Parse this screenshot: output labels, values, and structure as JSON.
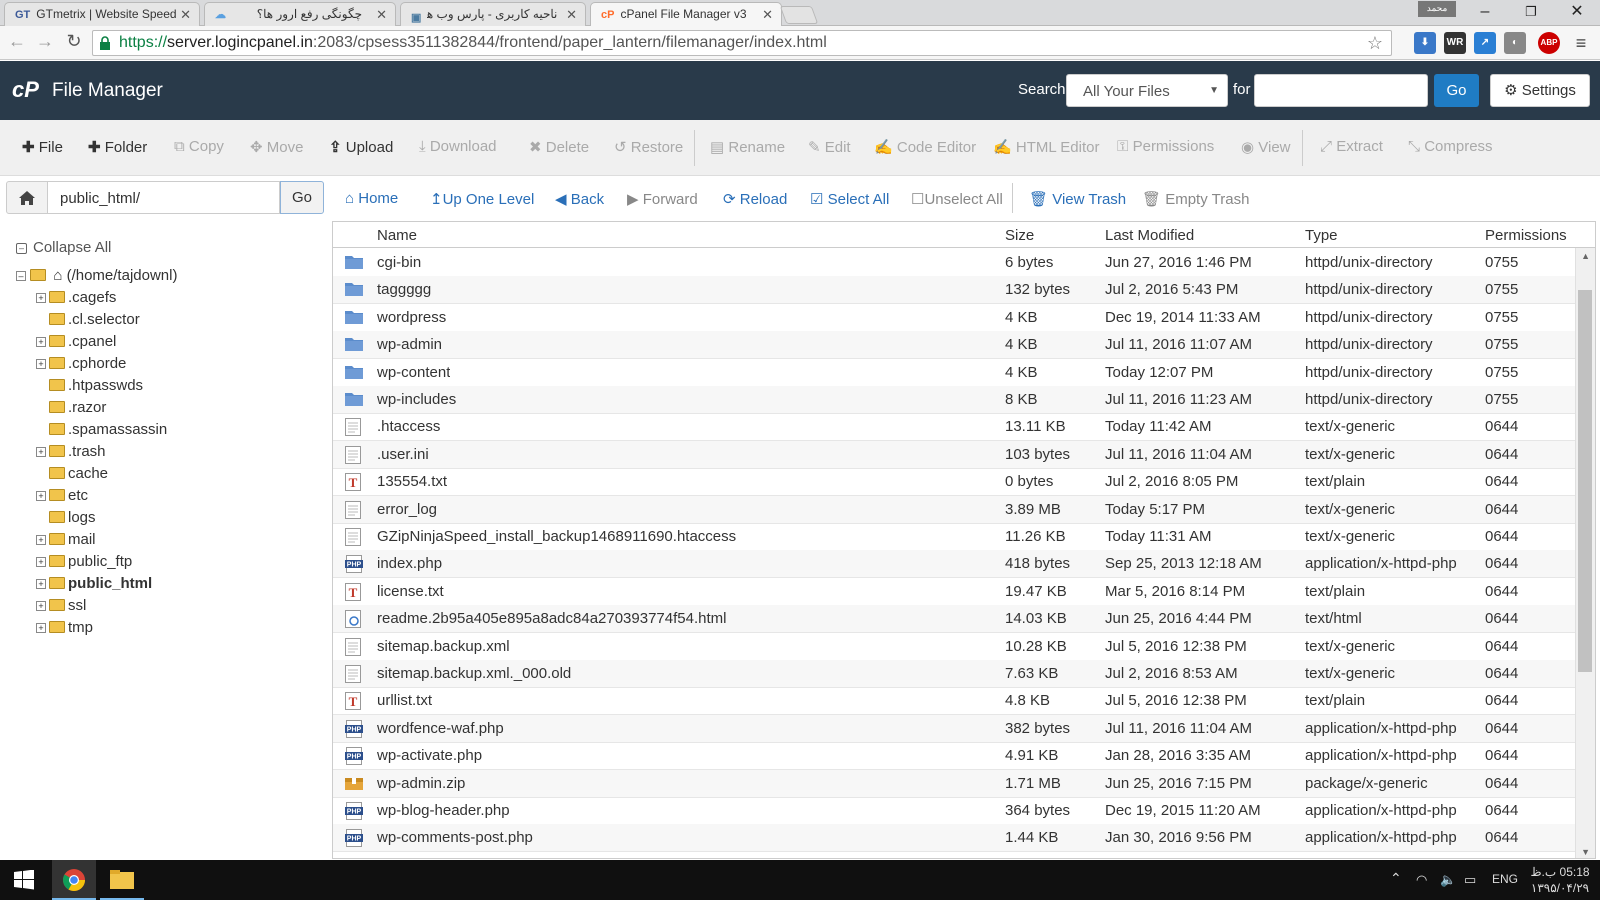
{
  "browser": {
    "tabs": [
      {
        "favicon": "GT",
        "title": "GTmetrix | Website Speed",
        "active": false
      },
      {
        "favicon": "cloud",
        "title": "چگونگی رفع ارور ها؟",
        "active": false
      },
      {
        "favicon": "page",
        "title": "ناحیه کاربری - پارس وب هاست",
        "active": false
      },
      {
        "favicon": "cP",
        "title": "cPanel File Manager v3",
        "active": true
      }
    ],
    "profile_name": "محمد",
    "url_scheme": "https://",
    "url_host": "server.logincpanel.in",
    "url_rest": ":2083/cpsess3511382844/frontend/paper_lantern/filemanager/index.html"
  },
  "header": {
    "logo": "cP",
    "title": "File Manager",
    "search_label": "Search",
    "search_scope": "All Your Files",
    "for_label": "for",
    "search_value": "",
    "go_label": "Go",
    "settings_label": "Settings"
  },
  "toolbar": [
    {
      "label": "File",
      "icon": "plus-icon",
      "enabled": true
    },
    {
      "label": "Folder",
      "icon": "plus-icon",
      "enabled": true
    },
    {
      "label": "Copy",
      "icon": "copy-icon",
      "enabled": false
    },
    {
      "label": "Move",
      "icon": "move-icon",
      "enabled": false
    },
    {
      "label": "Upload",
      "icon": "upload-icon",
      "enabled": true
    },
    {
      "label": "Download",
      "icon": "download-icon",
      "enabled": false
    },
    {
      "label": "Delete",
      "icon": "times-icon",
      "enabled": false
    },
    {
      "label": "Restore",
      "icon": "undo-icon",
      "enabled": false
    },
    {
      "label": "Rename",
      "icon": "file-icon",
      "enabled": false
    },
    {
      "label": "Edit",
      "icon": "pencil-icon",
      "enabled": false
    },
    {
      "label": "Code Editor",
      "icon": "edit-icon",
      "enabled": false
    },
    {
      "label": "HTML Editor",
      "icon": "edit-icon",
      "enabled": false
    },
    {
      "label": "Permissions",
      "icon": "key-icon",
      "enabled": false
    },
    {
      "label": "View",
      "icon": "eye-icon",
      "enabled": false
    },
    {
      "label": "Extract",
      "icon": "expand-icon",
      "enabled": false
    },
    {
      "label": "Compress",
      "icon": "compress-icon",
      "enabled": false
    }
  ],
  "pathbar": {
    "path": "public_html/",
    "go_label": "Go"
  },
  "nav": [
    {
      "label": "Home",
      "icon": "home-icon",
      "enabled": true
    },
    {
      "label": "Up One Level",
      "icon": "arrow-up-icon",
      "enabled": true
    },
    {
      "label": "Back",
      "icon": "arrow-left-icon",
      "enabled": true
    },
    {
      "label": "Forward",
      "icon": "arrow-right-icon",
      "enabled": false
    },
    {
      "label": "Reload",
      "icon": "refresh-icon",
      "enabled": true
    },
    {
      "label": "Select All",
      "icon": "checkbox-checked-icon",
      "enabled": true
    },
    {
      "label": "Unselect All",
      "icon": "checkbox-empty-icon",
      "enabled": false
    },
    {
      "label": "View Trash",
      "icon": "trash-icon",
      "enabled": true
    },
    {
      "label": "Empty Trash",
      "icon": "trash-icon",
      "enabled": false
    }
  ],
  "tree": {
    "collapse_label": "Collapse All",
    "root": "(/home/tajdownl)",
    "items": [
      {
        "name": ".cagefs",
        "expandable": true,
        "bold": false
      },
      {
        "name": ".cl.selector",
        "expandable": false,
        "bold": false
      },
      {
        "name": ".cpanel",
        "expandable": true,
        "bold": false
      },
      {
        "name": ".cphorde",
        "expandable": true,
        "bold": false
      },
      {
        "name": ".htpasswds",
        "expandable": false,
        "bold": false
      },
      {
        "name": ".razor",
        "expandable": false,
        "bold": false
      },
      {
        "name": ".spamassassin",
        "expandable": false,
        "bold": false
      },
      {
        "name": ".trash",
        "expandable": true,
        "bold": false
      },
      {
        "name": "cache",
        "expandable": false,
        "bold": false
      },
      {
        "name": "etc",
        "expandable": true,
        "bold": false
      },
      {
        "name": "logs",
        "expandable": false,
        "bold": false
      },
      {
        "name": "mail",
        "expandable": true,
        "bold": false
      },
      {
        "name": "public_ftp",
        "expandable": true,
        "bold": false
      },
      {
        "name": "public_html",
        "expandable": true,
        "bold": true
      },
      {
        "name": "ssl",
        "expandable": true,
        "bold": false
      },
      {
        "name": "tmp",
        "expandable": true,
        "bold": false
      }
    ]
  },
  "table": {
    "columns": [
      "Name",
      "Size",
      "Last Modified",
      "Type",
      "Permissions"
    ],
    "rows": [
      {
        "icon": "folder",
        "name": "cgi-bin",
        "size": "6 bytes",
        "modified": "Jun 27, 2016 1:46 PM",
        "type": "httpd/unix-directory",
        "perms": "0755"
      },
      {
        "icon": "folder",
        "name": "taggggg",
        "size": "132 bytes",
        "modified": "Jul 2, 2016 5:43 PM",
        "type": "httpd/unix-directory",
        "perms": "0755"
      },
      {
        "icon": "folder",
        "name": "wordpress",
        "size": "4 KB",
        "modified": "Dec 19, 2014 11:33 AM",
        "type": "httpd/unix-directory",
        "perms": "0755"
      },
      {
        "icon": "folder",
        "name": "wp-admin",
        "size": "4 KB",
        "modified": "Jul 11, 2016 11:07 AM",
        "type": "httpd/unix-directory",
        "perms": "0755"
      },
      {
        "icon": "folder",
        "name": "wp-content",
        "size": "4 KB",
        "modified": "Today 12:07 PM",
        "type": "httpd/unix-directory",
        "perms": "0755"
      },
      {
        "icon": "folder",
        "name": "wp-includes",
        "size": "8 KB",
        "modified": "Jul 11, 2016 11:23 AM",
        "type": "httpd/unix-directory",
        "perms": "0755"
      },
      {
        "icon": "generic",
        "name": ".htaccess",
        "size": "13.11 KB",
        "modified": "Today 11:42 AM",
        "type": "text/x-generic",
        "perms": "0644"
      },
      {
        "icon": "generic",
        "name": ".user.ini",
        "size": "103 bytes",
        "modified": "Jul 11, 2016 11:04 AM",
        "type": "text/x-generic",
        "perms": "0644"
      },
      {
        "icon": "text",
        "name": "135554.txt",
        "size": "0 bytes",
        "modified": "Jul 2, 2016 8:05 PM",
        "type": "text/plain",
        "perms": "0644"
      },
      {
        "icon": "generic",
        "name": "error_log",
        "size": "3.89 MB",
        "modified": "Today 5:17 PM",
        "type": "text/x-generic",
        "perms": "0644"
      },
      {
        "icon": "generic",
        "name": "GZipNinjaSpeed_install_backup1468911690.htaccess",
        "size": "11.26 KB",
        "modified": "Today 11:31 AM",
        "type": "text/x-generic",
        "perms": "0644"
      },
      {
        "icon": "php",
        "name": "index.php",
        "size": "418 bytes",
        "modified": "Sep 25, 2013 12:18 AM",
        "type": "application/x-httpd-php",
        "perms": "0644"
      },
      {
        "icon": "text",
        "name": "license.txt",
        "size": "19.47 KB",
        "modified": "Mar 5, 2016 8:14 PM",
        "type": "text/plain",
        "perms": "0644"
      },
      {
        "icon": "html",
        "name": "readme.2b95a405e895a8adc84a270393774f54.html",
        "size": "14.03 KB",
        "modified": "Jun 25, 2016 4:44 PM",
        "type": "text/html",
        "perms": "0644"
      },
      {
        "icon": "generic",
        "name": "sitemap.backup.xml",
        "size": "10.28 KB",
        "modified": "Jul 5, 2016 12:38 PM",
        "type": "text/x-generic",
        "perms": "0644"
      },
      {
        "icon": "generic",
        "name": "sitemap.backup.xml._000.old",
        "size": "7.63 KB",
        "modified": "Jul 2, 2016 8:53 AM",
        "type": "text/x-generic",
        "perms": "0644"
      },
      {
        "icon": "text",
        "name": "urllist.txt",
        "size": "4.8 KB",
        "modified": "Jul 5, 2016 12:38 PM",
        "type": "text/plain",
        "perms": "0644"
      },
      {
        "icon": "php",
        "name": "wordfence-waf.php",
        "size": "382 bytes",
        "modified": "Jul 11, 2016 11:04 AM",
        "type": "application/x-httpd-php",
        "perms": "0644"
      },
      {
        "icon": "php",
        "name": "wp-activate.php",
        "size": "4.91 KB",
        "modified": "Jan 28, 2016 3:35 AM",
        "type": "application/x-httpd-php",
        "perms": "0644"
      },
      {
        "icon": "archive",
        "name": "wp-admin.zip",
        "size": "1.71 MB",
        "modified": "Jun 25, 2016 7:15 PM",
        "type": "package/x-generic",
        "perms": "0644"
      },
      {
        "icon": "php",
        "name": "wp-blog-header.php",
        "size": "364 bytes",
        "modified": "Dec 19, 2015 11:20 AM",
        "type": "application/x-httpd-php",
        "perms": "0644"
      },
      {
        "icon": "php",
        "name": "wp-comments-post.php",
        "size": "1.44 KB",
        "modified": "Jan 30, 2016 9:56 PM",
        "type": "application/x-httpd-php",
        "perms": "0644"
      }
    ]
  },
  "taskbar": {
    "language": "ENG",
    "time": "05:18 ب.ظ",
    "date": "۱۳۹۵/۰۴/۲۹"
  },
  "colors": {
    "header_bg": "#293a4a",
    "accent": "#1f7cc4",
    "link": "#2a6fb8",
    "folder_blue": "#5b8ccc"
  }
}
